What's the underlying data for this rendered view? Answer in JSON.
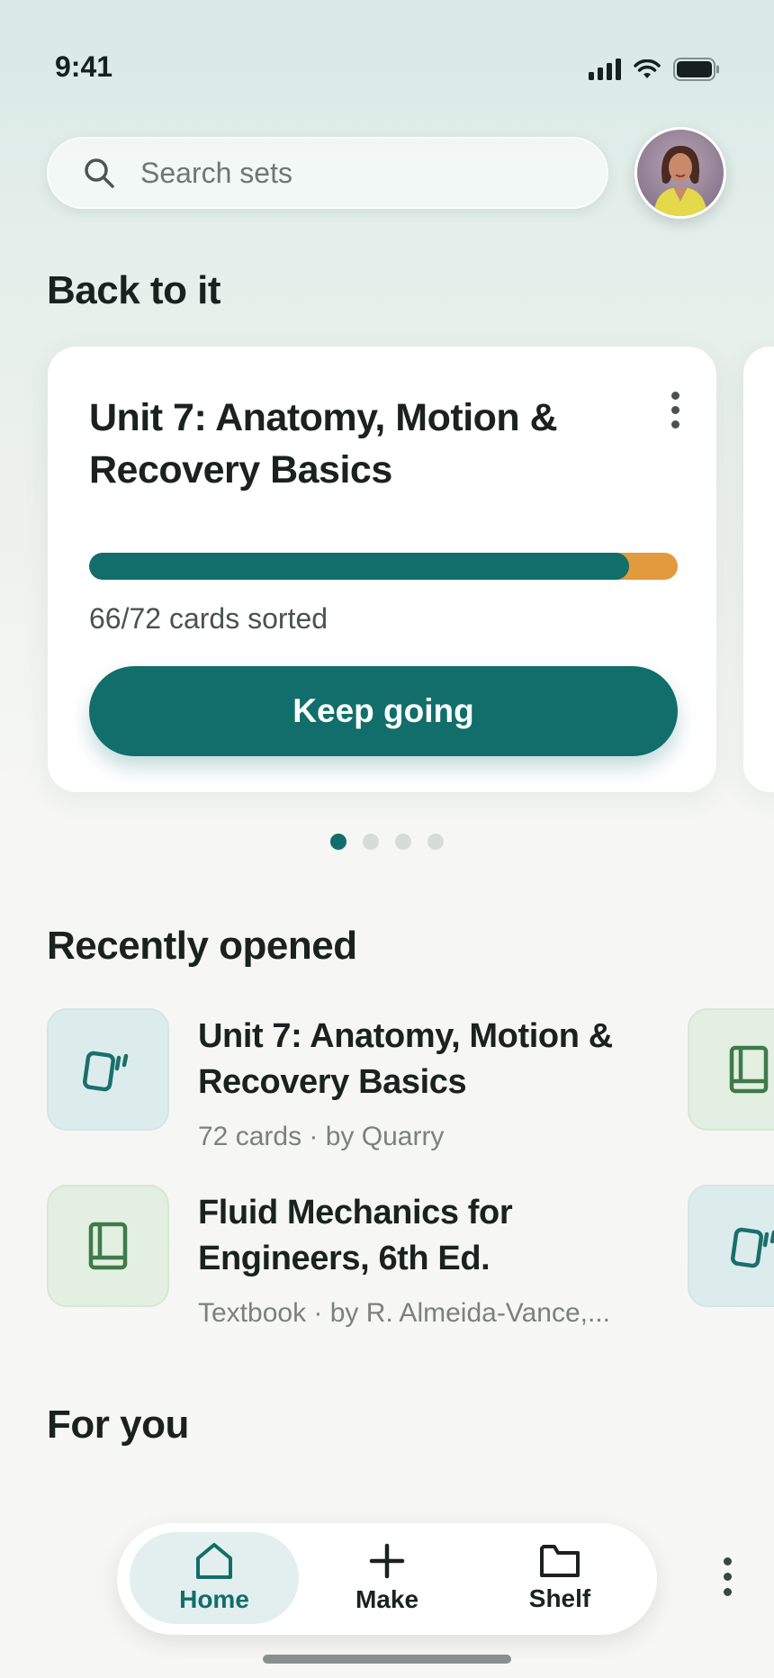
{
  "status_bar": {
    "time": "9:41"
  },
  "search": {
    "placeholder": "Search sets"
  },
  "sections": {
    "back_to_it": "Back to it",
    "recently_opened": "Recently opened",
    "for_you": "For you"
  },
  "resume_card": {
    "title": "Unit 7: Anatomy, Motion & Recovery Basics",
    "progress_text": "66/72 cards sorted",
    "progress": {
      "done": 66,
      "total": 72
    },
    "button_label": "Keep going"
  },
  "carousel": {
    "pages": 4,
    "active_index": 0
  },
  "recent": [
    {
      "title": "Unit 7: Anatomy, Motion & Recovery Basics",
      "meta": "72 cards · by Quarry",
      "icon": "flashcards-icon"
    },
    {
      "title": "Fluid Mechanics for Engineers, 6th Ed.",
      "meta": "Textbook · by R. Almeida-Vance,...",
      "icon": "book-icon"
    }
  ],
  "tabs": [
    {
      "label": "Home",
      "icon": "home-icon",
      "active": true
    },
    {
      "label": "Make",
      "icon": "plus-icon",
      "active": false
    },
    {
      "label": "Shelf",
      "icon": "folder-icon",
      "active": false
    }
  ],
  "colors": {
    "accent": "#116e6a",
    "progress_remaining": "#e19a3d",
    "tab_active_bg": "#e3efee"
  }
}
